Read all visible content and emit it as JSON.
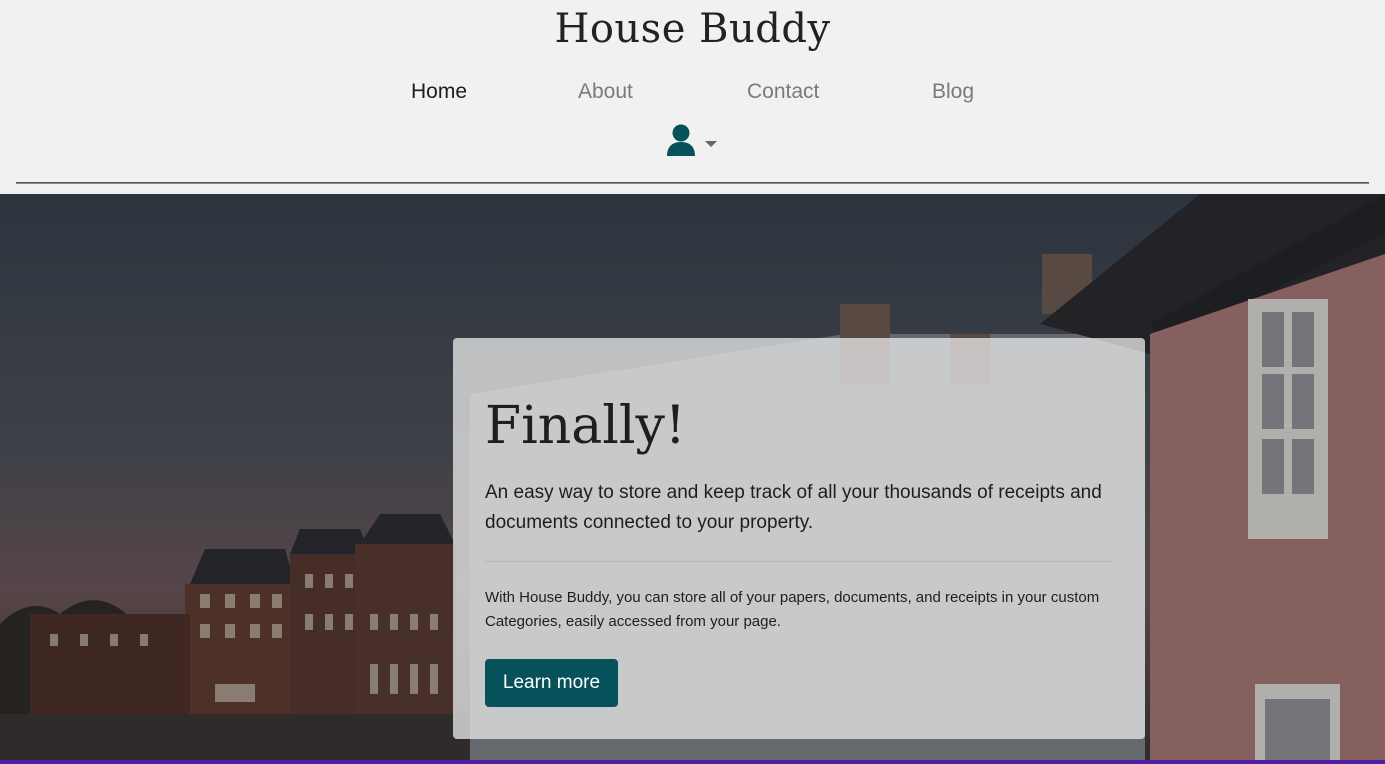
{
  "header": {
    "brand": "House Buddy",
    "nav": [
      {
        "label": "Home",
        "active": true
      },
      {
        "label": "About",
        "active": false
      },
      {
        "label": "Contact",
        "active": false
      },
      {
        "label": "Blog",
        "active": false
      }
    ],
    "user_menu": {
      "icon": "user-icon",
      "caret": "caret-down-icon"
    }
  },
  "hero": {
    "background": "photo-of-brick-townhouses-under-cloudy-sky",
    "title": "Finally!",
    "lead": "An easy way to store and keep track of all your thousands of receipts and documents connected to your property.",
    "body": "With House Buddy, you can store all of your papers, documents, and receipts in your custom Categories, easily accessed from your page.",
    "button_label": "Learn more"
  },
  "colors": {
    "brand_accent": "#07525a",
    "header_bg": "#f1f1f1",
    "text": "#1e1e1e",
    "nav_inactive": "#7a7a7a"
  }
}
